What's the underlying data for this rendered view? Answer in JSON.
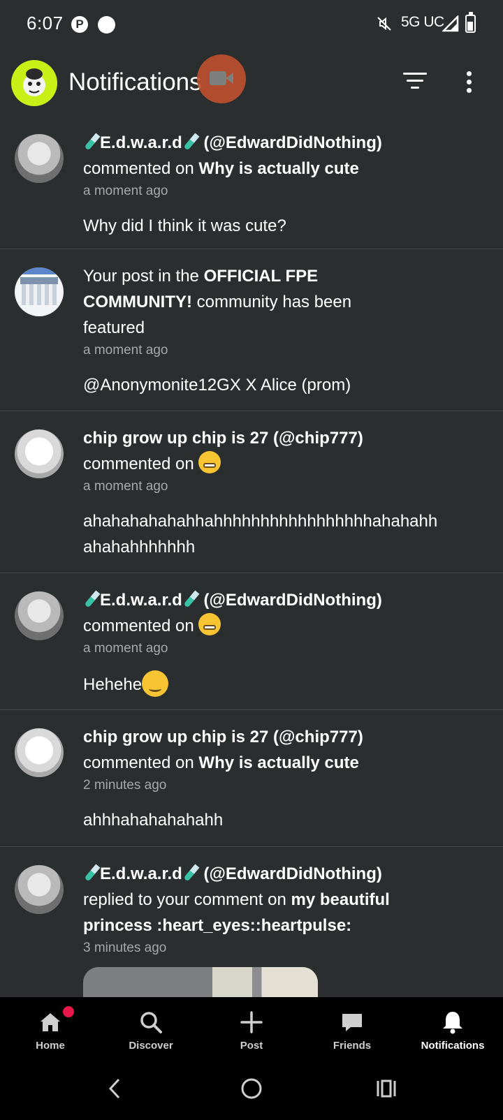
{
  "status_bar": {
    "time": "6:07",
    "network": "5G UC"
  },
  "app_bar": {
    "title": "Notifications"
  },
  "notifications": [
    {
      "actor": "E.d.w.a.r.d",
      "handle": "(@EdwardDidNothing)",
      "action": "commented on ",
      "target": "Why is actually cute",
      "time": "a moment ago",
      "preview": "Why did I think it was cute?"
    },
    {
      "prefix": "Your post in the ",
      "community": "OFFICIAL FPE",
      "community2": "COMMUNITY!",
      "suffix": " community has been",
      "suffix2": "featured",
      "time": "a moment ago",
      "preview": "@Anonymonite12GX X Alice (prom)"
    },
    {
      "actor": "chip grow up chip is 27 (@chip777)",
      "action": "commented on ",
      "target_emoji": "grimacing",
      "time": "a moment ago",
      "preview": "ahahahahahahhahhhhhhhhhhhhhhhhhahahahh",
      "preview2": "ahahahhhhhhh"
    },
    {
      "actor": "E.d.w.a.r.d",
      "handle": "(@EdwardDidNothing)",
      "action": "commented on ",
      "target_emoji": "grimacing",
      "time": "a moment ago",
      "preview": "Hehehe",
      "preview_emoji": "smirking"
    },
    {
      "actor": "chip grow up chip is 27 (@chip777)",
      "action": "commented on ",
      "target": "Why is actually cute",
      "time": "2 minutes ago",
      "preview": "ahhhahahahahahh"
    },
    {
      "actor": "E.d.w.a.r.d",
      "handle": "(@EdwardDidNothing)",
      "action": "replied to your comment on ",
      "target": "my beautiful",
      "target2": "princess :heart_eyes::heartpulse:",
      "time": "3 minutes ago"
    }
  ],
  "bottom_nav": [
    {
      "label": "Home",
      "icon": "home-icon",
      "badge": true
    },
    {
      "label": "Discover",
      "icon": "search-icon"
    },
    {
      "label": "Post",
      "icon": "plus-icon"
    },
    {
      "label": "Friends",
      "icon": "chat-bubble-icon"
    },
    {
      "label": "Notifications",
      "icon": "bell-icon",
      "active": true
    }
  ],
  "colors": {
    "background": "#2b2e2f",
    "divider": "#474b4c",
    "badge": "#e8174a",
    "logo": "#c8f016"
  }
}
